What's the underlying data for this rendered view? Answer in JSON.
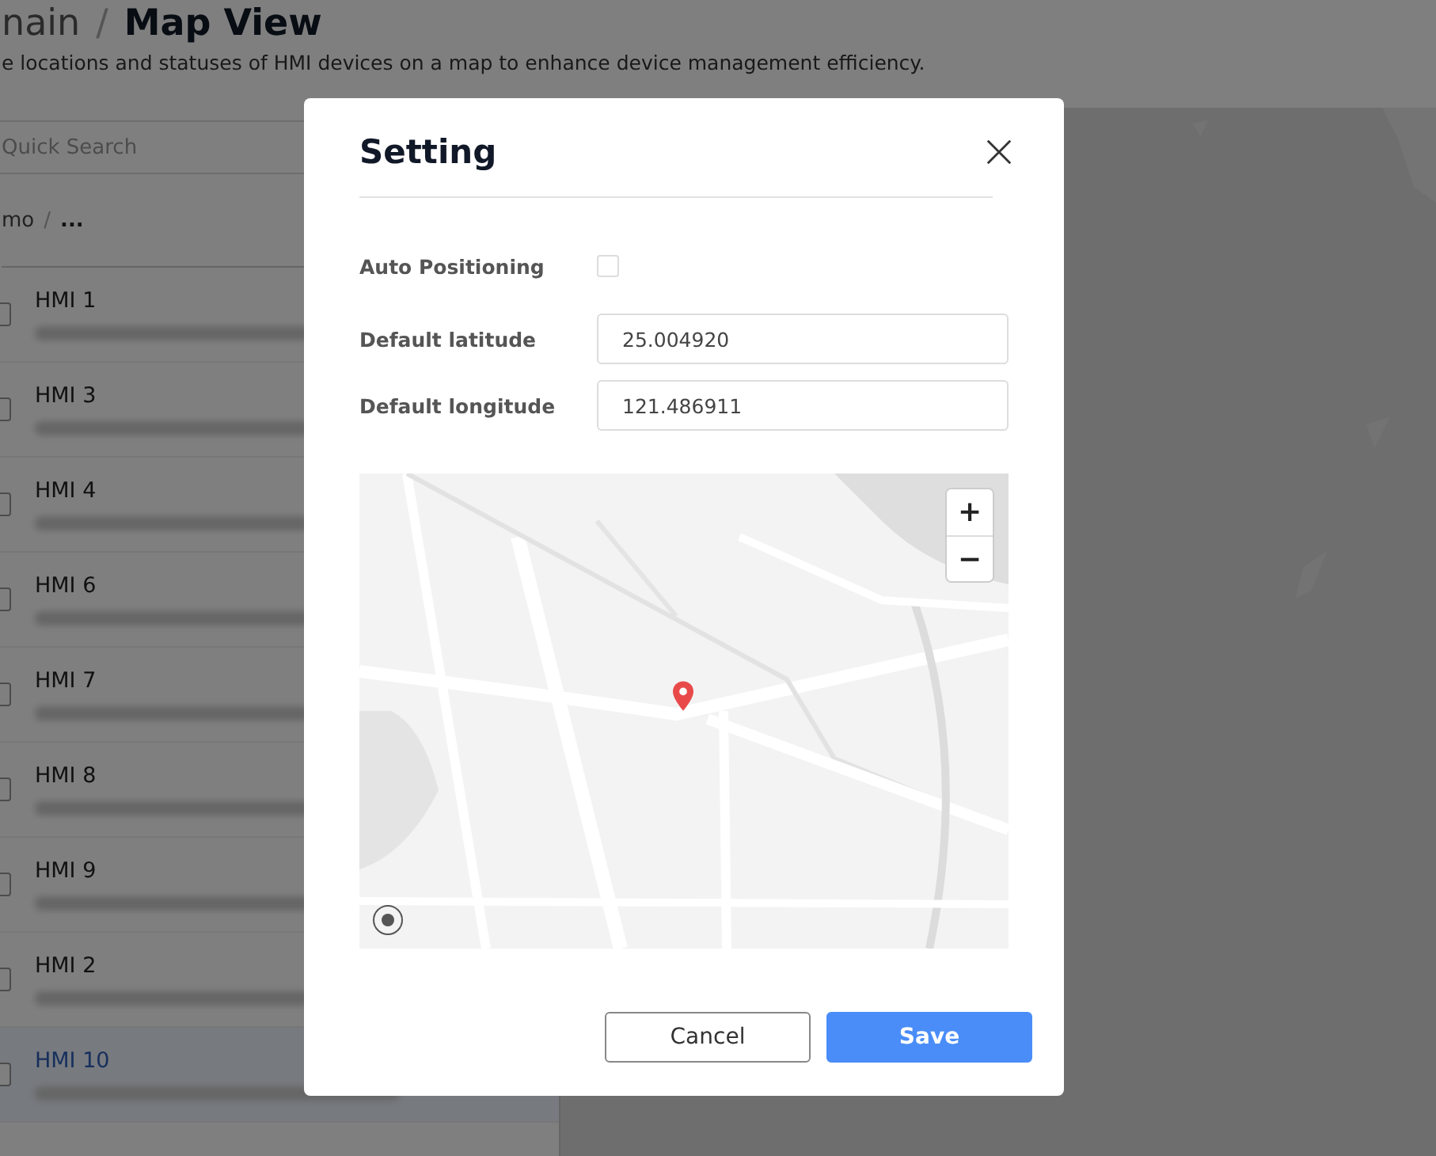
{
  "header": {
    "parent": "nain",
    "separator": "/",
    "title": "Map View",
    "description": "e locations and statuses of HMI devices on a map to enhance device management efficiency."
  },
  "search": {
    "placeholder": "Quick Search"
  },
  "path": {
    "parent": "mo",
    "separator": "/",
    "current": "..."
  },
  "devices": [
    {
      "name": "HMI 1",
      "checked": false,
      "selected": false
    },
    {
      "name": "HMI 3",
      "checked": false,
      "selected": false
    },
    {
      "name": "HMI 4",
      "checked": false,
      "selected": false
    },
    {
      "name": "HMI 6",
      "checked": false,
      "selected": false
    },
    {
      "name": "HMI 7",
      "checked": false,
      "selected": false
    },
    {
      "name": "HMI 8",
      "checked": false,
      "selected": false
    },
    {
      "name": "HMI 9",
      "checked": false,
      "selected": false
    },
    {
      "name": "HMI 2",
      "checked": false,
      "selected": false
    },
    {
      "name": "HMI 10",
      "checked": false,
      "selected": true
    }
  ],
  "dialog": {
    "title": "Setting",
    "fields": [
      {
        "kind": "checkbox",
        "label": "Auto Positioning",
        "checked": false
      },
      {
        "kind": "text",
        "label": "Default latitude",
        "value": "25.004920"
      },
      {
        "kind": "text",
        "label": "Default longitude",
        "value": "121.486911"
      }
    ],
    "map": {
      "kind": "picture",
      "zoom_in": "+",
      "zoom_out": "−"
    },
    "buttons": [
      {
        "label": "Cancel",
        "kind": "secondary"
      },
      {
        "label": "Save",
        "kind": "primary"
      }
    ]
  }
}
